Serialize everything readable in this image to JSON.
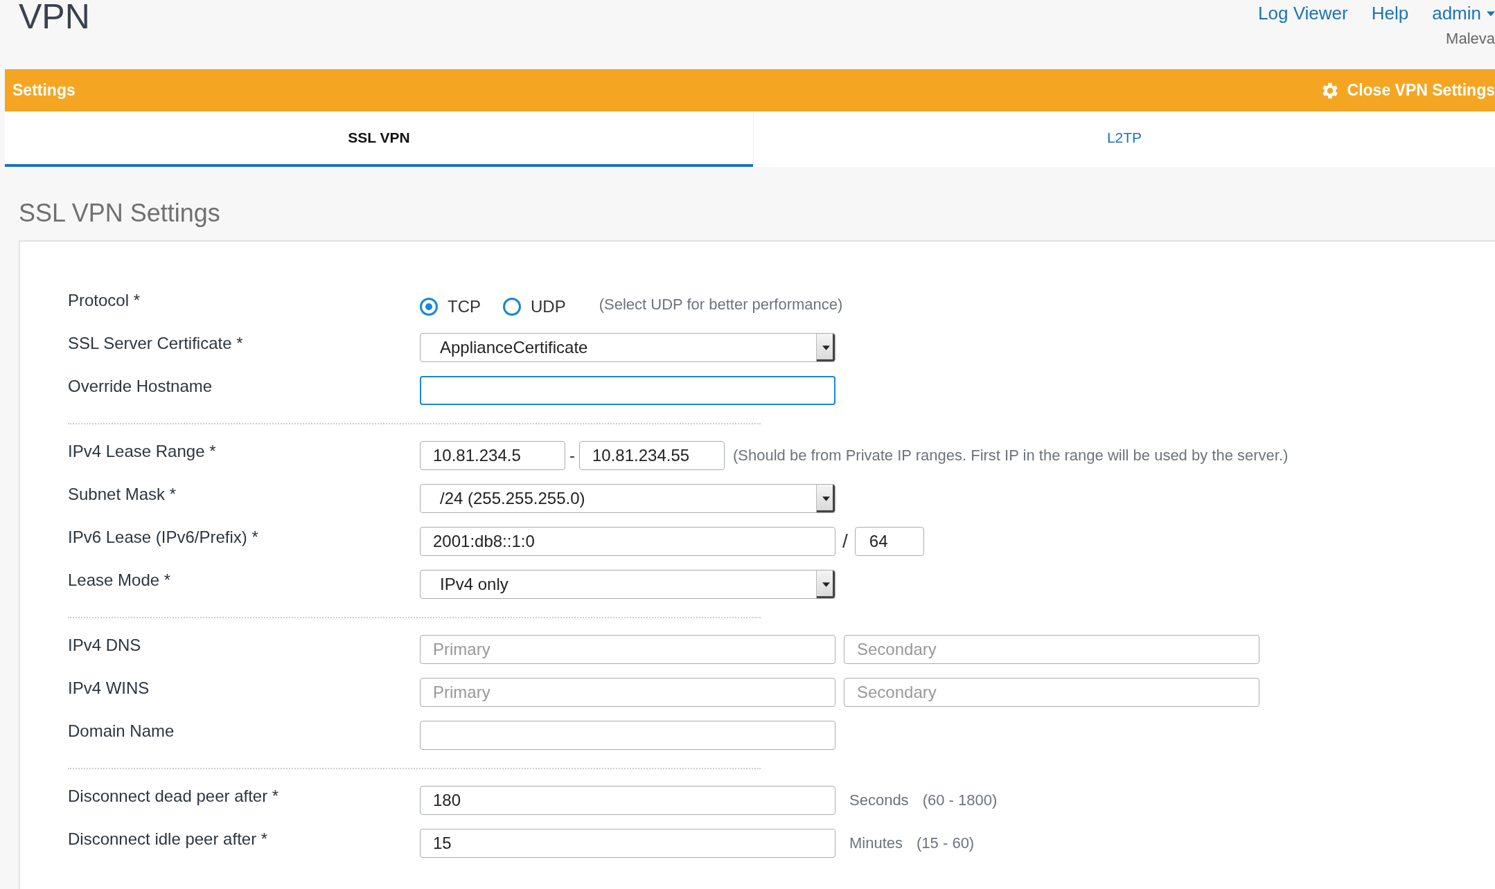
{
  "page": {
    "title": "VPN"
  },
  "top_links": [
    {
      "label": "Log Viewer",
      "kind": "link"
    },
    {
      "label": "Help",
      "kind": "link"
    },
    {
      "label": "admin",
      "kind": "menu"
    }
  ],
  "top_subtitle": "Maleva",
  "settings_bar": {
    "title": "Settings",
    "action": "Close VPN Settings"
  },
  "tabs": [
    {
      "label": "SSL VPN",
      "selected": true
    },
    {
      "label": "L2TP",
      "selected": false
    }
  ],
  "section": {
    "title": "SSL VPN Settings"
  },
  "rows": [
    {
      "kind": "radio",
      "label": "Protocol *",
      "options": [
        {
          "label": "TCP",
          "selected": true
        },
        {
          "label": "UDP",
          "selected": false
        }
      ],
      "hint": "(Select UDP for better performance)"
    },
    {
      "kind": "select",
      "label": "SSL Server Certificate *",
      "value": "ApplianceCertificate"
    },
    {
      "kind": "input",
      "label": "Override Hostname",
      "focused": true
    },
    {
      "kind": "divider"
    },
    {
      "kind": "range",
      "label": "IPv4 Lease Range *",
      "from": "10.81.234.5",
      "separator": "-",
      "to": "10.81.234.55",
      "hint": "(Should be from Private IP ranges. First IP in the range will be used by the server.)"
    },
    {
      "kind": "select",
      "label": "Subnet Mask *",
      "value": "/24 (255.255.255.0)"
    },
    {
      "kind": "prefix",
      "label": "IPv6 Lease (IPv6/Prefix) *",
      "value": "2001:db8::1:0",
      "separator": "/",
      "prefix": "64"
    },
    {
      "kind": "select",
      "label": "Lease Mode *",
      "value": "IPv4 only"
    },
    {
      "kind": "divider"
    },
    {
      "kind": "pair",
      "label": "IPv4 DNS",
      "placeholders": [
        "Primary",
        "Secondary"
      ]
    },
    {
      "kind": "pair",
      "label": "IPv4 WINS",
      "placeholders": [
        "Primary",
        "Secondary"
      ]
    },
    {
      "kind": "input",
      "label": "Domain Name",
      "focused": false
    },
    {
      "kind": "divider"
    },
    {
      "kind": "unit",
      "label": "Disconnect dead peer after *",
      "value": "180",
      "unit": "Seconds",
      "range": "(60 - 1800)"
    },
    {
      "kind": "unit",
      "label": "Disconnect idle peer after *",
      "value": "15",
      "unit": "Minutes",
      "range": "(15 - 60)"
    }
  ]
}
